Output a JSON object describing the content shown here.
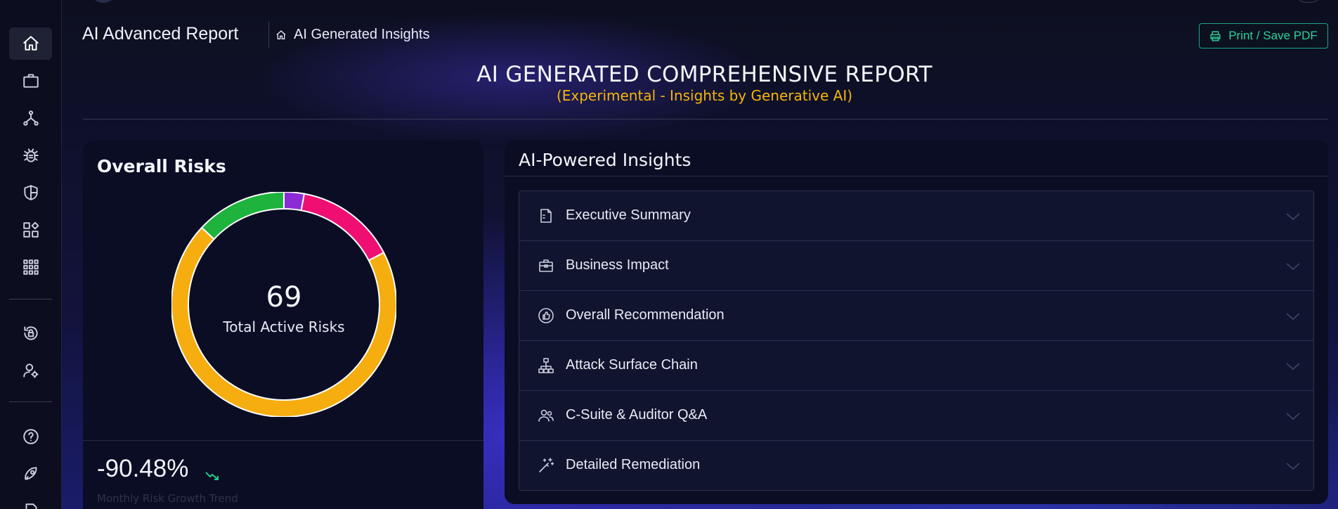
{
  "header": {
    "app_title": "AI Advanced Report",
    "breadcrumb": "AI Generated Insights",
    "print_button": "Print / Save PDF"
  },
  "report": {
    "title": "AI GENERATED COMPREHENSIVE REPORT",
    "subtitle": "(Experimental - Insights by Generative AI)"
  },
  "sidebar": {
    "items": [
      {
        "icon": "home-icon",
        "active": true
      },
      {
        "icon": "briefcase-icon"
      },
      {
        "icon": "network-icon"
      },
      {
        "icon": "bug-icon"
      },
      {
        "icon": "shield-icon"
      },
      {
        "icon": "widgets-icon"
      },
      {
        "icon": "apps-grid-icon"
      },
      {
        "icon": "history-lock-icon"
      },
      {
        "icon": "user-settings-icon"
      },
      {
        "icon": "help-icon"
      },
      {
        "icon": "rocket-icon"
      }
    ]
  },
  "overall_risks": {
    "title": "Overall Risks",
    "total": "69",
    "total_label": "Total Active Risks",
    "trend_value": "-90.48%",
    "trend_label": "Monthly Risk Growth Trend",
    "colors": {
      "low": "#1db33d",
      "info": "#8b2bd6",
      "high": "#ef0f72",
      "medium": "#f6ad0f"
    }
  },
  "chart_data": {
    "type": "pie",
    "title": "Overall Risks",
    "center_value": 69,
    "center_label": "Total Active Risks",
    "slices": [
      {
        "value": 2,
        "color": "#8b2bd6"
      },
      {
        "value": 10,
        "color": "#ef0f72"
      },
      {
        "value": 48,
        "color": "#f6ad0f"
      },
      {
        "value": 9,
        "color": "#1db33d"
      }
    ]
  },
  "insights": {
    "title": "AI-Powered Insights",
    "items": [
      {
        "label": "Executive Summary",
        "icon": "document-icon"
      },
      {
        "label": "Business Impact",
        "icon": "briefcase-icon"
      },
      {
        "label": "Overall Recommendation",
        "icon": "thumbs-up-icon"
      },
      {
        "label": "Attack Surface Chain",
        "icon": "hierarchy-icon"
      },
      {
        "label": "C-Suite & Auditor Q&A",
        "icon": "users-icon"
      },
      {
        "label": "Detailed Remediation",
        "icon": "magic-wand-icon"
      }
    ]
  }
}
